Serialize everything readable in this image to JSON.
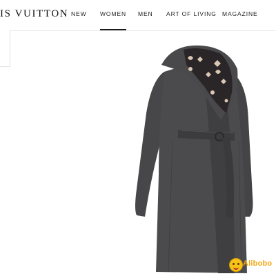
{
  "brand": {
    "logo_text": "IS VUITTON"
  },
  "nav": {
    "items": [
      {
        "label": "NEW"
      },
      {
        "label": "WOMEN",
        "active": true
      },
      {
        "label": "MEN"
      },
      {
        "label": "ART OF LIVING"
      },
      {
        "label": "MAGAZINE"
      }
    ]
  },
  "product": {
    "image": "hooded-wrap-coat-image",
    "color": "#4a4a4c",
    "lining_monogram": "LV"
  },
  "watermark": {
    "text": "Alibobo",
    "icon": "smiley-face-icon"
  }
}
